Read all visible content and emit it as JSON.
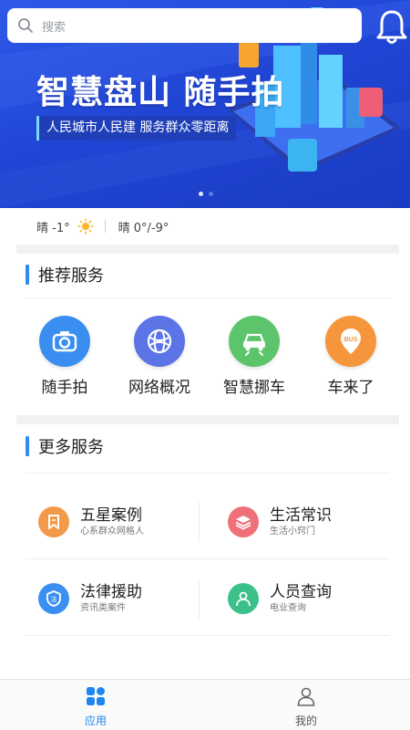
{
  "search": {
    "placeholder": "搜索"
  },
  "banner": {
    "headline": "智慧盘山 随手拍",
    "subline": "人民城市人民建 服务群众零距离",
    "page_count": 2,
    "active_page": 1
  },
  "weather": {
    "current": "晴 -1°",
    "forecast": "晴  0°/-9°"
  },
  "recommended": {
    "title": "推荐服务",
    "items": [
      {
        "label": "随手拍",
        "icon": "camera-icon",
        "color": "#3a8ef0"
      },
      {
        "label": "网络概况",
        "icon": "globe-icon",
        "color": "#5b74e6"
      },
      {
        "label": "智慧挪车",
        "icon": "car-move-icon",
        "color": "#5cc46a"
      },
      {
        "label": "车来了",
        "icon": "bus-pin-icon",
        "color": "#f5963c"
      }
    ]
  },
  "more": {
    "title": "更多服务",
    "items": [
      {
        "title": "五星案例",
        "subtitle": "心系群众网格人",
        "icon": "bookmark-icon",
        "color": "#f39a4a"
      },
      {
        "title": "生活常识",
        "subtitle": "生活小窍门",
        "icon": "layers-icon",
        "color": "#ef6f7a"
      },
      {
        "title": "法律援助",
        "subtitle": "资讯类案件",
        "icon": "law-shield-icon",
        "color": "#3b8ff0"
      },
      {
        "title": "人员查询",
        "subtitle": "电业查询",
        "icon": "person-search-icon",
        "color": "#3cc08a"
      }
    ]
  },
  "tabbar": {
    "tabs": [
      {
        "label": "应用",
        "icon": "apps-icon",
        "active": true
      },
      {
        "label": "我的",
        "icon": "profile-icon",
        "active": false
      }
    ],
    "active_color": "#1f86f0"
  }
}
